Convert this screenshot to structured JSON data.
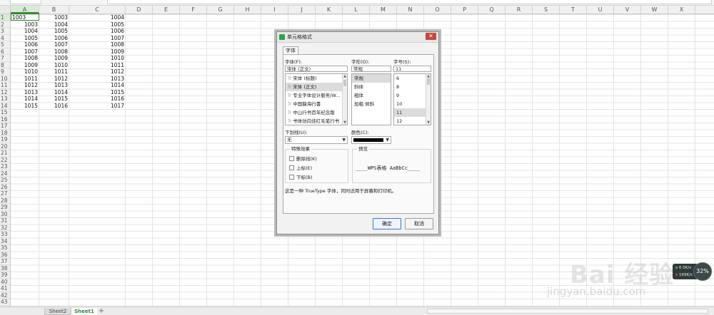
{
  "columns": [
    "A",
    "B",
    "C",
    "D",
    "E",
    "F",
    "G",
    "H",
    "I",
    "J",
    "K",
    "L",
    "M",
    "N",
    "O",
    "P",
    "Q",
    "R",
    "S",
    "T",
    "U",
    "V",
    "W",
    "X"
  ],
  "active_column": "A",
  "rows": [
    "1",
    "2",
    "3",
    "4",
    "5",
    "6",
    "7",
    "8",
    "9",
    "10",
    "11",
    "12",
    "13",
    "14",
    "15",
    "16",
    "17",
    "18",
    "19",
    "20",
    "21",
    "22",
    "23",
    "24",
    "25",
    "26",
    "27",
    "28",
    "29",
    "30",
    "31",
    "32",
    "33",
    "34",
    "35",
    "36",
    "37",
    "38",
    "39",
    "40",
    "41",
    "42",
    "43",
    "44"
  ],
  "active_row": "1",
  "cells": [
    {
      "a": "1003",
      "b": "1003",
      "c": "1004"
    },
    {
      "a": "1003",
      "b": "1004",
      "c": "1005"
    },
    {
      "a": "1004",
      "b": "1005",
      "c": "1006"
    },
    {
      "a": "1005",
      "b": "1006",
      "c": "1007"
    },
    {
      "a": "1006",
      "b": "1007",
      "c": "1008"
    },
    {
      "a": "1007",
      "b": "1008",
      "c": "1009"
    },
    {
      "a": "1008",
      "b": "1009",
      "c": "1010"
    },
    {
      "a": "1009",
      "b": "1010",
      "c": "1011"
    },
    {
      "a": "1010",
      "b": "1011",
      "c": "1012"
    },
    {
      "a": "1011",
      "b": "1012",
      "c": "1013"
    },
    {
      "a": "1012",
      "b": "1013",
      "c": "1014"
    },
    {
      "a": "1013",
      "b": "1014",
      "c": "1015"
    },
    {
      "a": "1014",
      "b": "1015",
      "c": "1016"
    },
    {
      "a": "1015",
      "b": "1016",
      "c": "1017"
    }
  ],
  "sheet_tabs": {
    "sheet2": "Sheet2",
    "sheet1": "Sheet1",
    "add": "+"
  },
  "dialog": {
    "title": "单元格格式",
    "close": "✕",
    "tab": "字体",
    "font_label": "字体(F):",
    "font_value": "宋体 (正文)",
    "font_list": [
      "宋体 (标题)",
      "宋体 (正文)",
      "专业字体设计服务/W...",
      "中国龍海行書",
      "中山行书百年纪念版",
      "书体坊向佳红毛笔行书"
    ],
    "font_selected_index": 1,
    "font_ttf_mark": "Tr",
    "style_label": "字形(O):",
    "style_value": "常规",
    "style_list": [
      "常规",
      "斜体",
      "粗体",
      "加粗 倾斜"
    ],
    "style_selected_index": 0,
    "size_label": "字号(S):",
    "size_value": "11",
    "size_list": [
      "6",
      "8",
      "9",
      "10",
      "11",
      "12"
    ],
    "size_selected_index": 4,
    "underline_label": "下划线(U):",
    "underline_value": "无",
    "color_label": "颜色(C):",
    "color_value": "#000000",
    "effects_title": "特殊效果",
    "effects": [
      "删除线(K)",
      "上标(E)",
      "下标(B)"
    ],
    "preview_title": "预览",
    "preview_text": "____WPS表格  AaBbCc____",
    "description": "这是一种 TrueType 字体，同时适用于屏幕和打印机。",
    "ok": "确定",
    "cancel": "取消"
  },
  "watermark": {
    "brand": "Bai 经验",
    "url": "jingyan.baidu.com"
  },
  "widget": {
    "line1": "6.5K/s",
    "line2": "169K/s",
    "percent": "32%",
    "up_color": "#4caf50",
    "down_color": "#e53935"
  }
}
